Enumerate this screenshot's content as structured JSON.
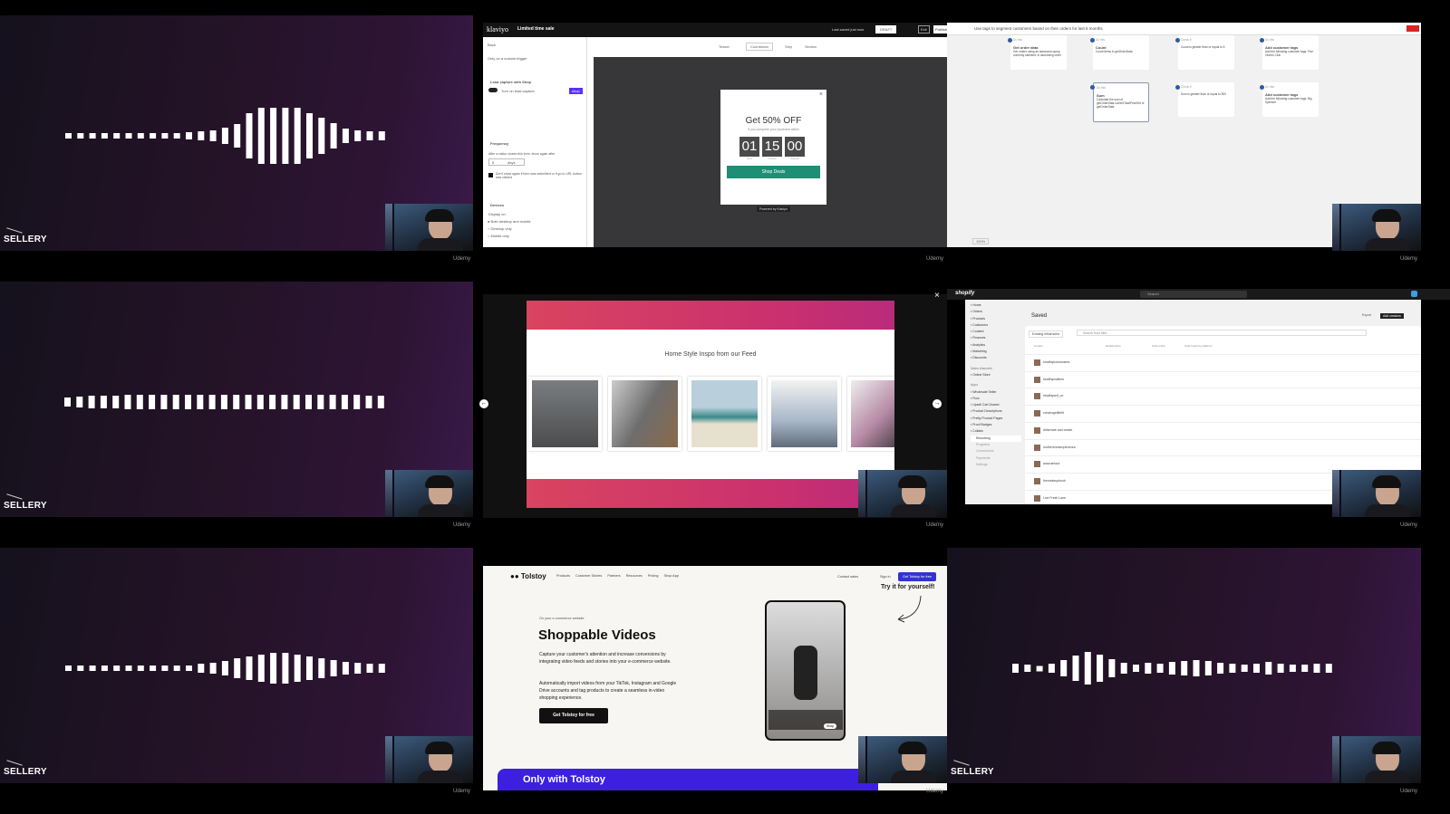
{
  "brand_logo": "SELLERY",
  "platform_label": "Udemy",
  "colors": {
    "bg_purple": "#2d1434",
    "klaviyo_teal": "#1e8e74",
    "tolstoy_blue": "#3533cd",
    "pink_banner": "#d2436a"
  },
  "klaviyo": {
    "app": "klaviyo",
    "title": "Limited time sale",
    "status": "Last saved just now",
    "status_select": "DRAFT",
    "exit": "Exit",
    "publish": "Publish",
    "back": "Back",
    "toolbar": [
      "Teaser",
      "Countdown",
      "Step",
      "Section"
    ],
    "trigger_option": "Only on a custom trigger",
    "lead_capture": {
      "heading": "Lead capture with Shop",
      "toggle_label": "Turn on lead capture",
      "badge": "shop"
    },
    "frequency": {
      "heading": "Frequency",
      "desc": "After a visitor closes this form, show again after",
      "value": "5",
      "unit": "days",
      "checkbox": "Don't show again if form was submitted or if go to URL button was clicked"
    },
    "devices": {
      "heading": "Devices",
      "label": "Display on",
      "options": [
        "Both desktop and mobile",
        "Desktop only",
        "Mobile only"
      ],
      "selected": 0
    },
    "popup": {
      "headline": "Get 50% OFF",
      "sub": "If you complete your purchase within",
      "timer": [
        "01",
        "15",
        "00"
      ],
      "timer_units": [
        "hours",
        "minutes",
        "seconds"
      ],
      "cta": "Shop Deals",
      "footer": "Powered by Klaviyo"
    }
  },
  "flow": {
    "title": "Use tags to segment customers based on their orders for last 6 months",
    "nodes": [
      {
        "label": "Do this",
        "title": "Get order data",
        "desc": "Get orders using an advanced query, currently selected: in ascending order"
      },
      {
        "label": "Do this",
        "title": "Count",
        "desc": "Count items in getOrderData"
      },
      {
        "label": "Check if",
        "title": "",
        "desc": "Count is greater than or equal to 5"
      },
      {
        "label": "Do this",
        "title": "Add customer tags",
        "desc": "Add the following customer tags: Five Orders Club"
      },
      {
        "label": "Do this",
        "title": "Sum",
        "desc": "Calculate the sum of getOrderData.currentTotalPriceSet of getOrderData"
      },
      {
        "label": "Check if",
        "title": "",
        "desc": "Sum is greater than or equal to 500"
      },
      {
        "label": "Do this",
        "title": "Add customer tags",
        "desc": "Add the following customer tags: Big Spender"
      }
    ],
    "zoom": "100%"
  },
  "carousel": {
    "heading": "Home Style Inspo from our Feed"
  },
  "shopify": {
    "app": "shopify",
    "search": "Search",
    "nav": [
      "Home",
      "Orders",
      "Products",
      "Customers",
      "Content",
      "Finances",
      "Analytics",
      "Marketing",
      "Discounts"
    ],
    "sales_channels": "Sales channels",
    "online_store": "Online Store",
    "apps_label": "Apps",
    "apps": [
      "Wholesale Seller",
      "Flow",
      "Upsell Cart Drawer",
      "Product Descriptions",
      "Pretty Product Pages",
      "Proof Badges",
      "Collabs"
    ],
    "collabs_sub": [
      "Recruiting",
      "Programs",
      "Connections",
      "Payments",
      "Settings"
    ],
    "settings": "Settings",
    "page_title": "Saved",
    "actions": [
      "Export",
      "Add creators"
    ],
    "filter": "Existing influencers",
    "search_placeholder": "Search from files",
    "columns": [
      "Creator",
      "Relationship",
      "Total reach",
      "Total reach by platform"
    ],
    "rows": [
      "healthyhomewares",
      "healthymatters",
      "healthyself_co",
      "creatorgetlifefit",
      "ditherrate and create",
      "mothercreatorpreneurs",
      "anavuefood",
      "themakeupbook",
      "Live Fresh Lane"
    ]
  },
  "tolstoy": {
    "brand": "Tolstoy",
    "nav": [
      "Products",
      "Customer Stories",
      "Partners",
      "Resources",
      "Pricing",
      "Shop App"
    ],
    "contact": "Contact sales",
    "signin": "Sign in",
    "cta_top": "Get Tolstoy for free",
    "try": "Try it for yourself!",
    "eyebrow": "On your e-commerce website",
    "headline": "Shoppable Videos",
    "p1": "Capture your customer's attention and increase conversions by integrating video feeds and stories into your e-commerce website.",
    "p2": "Automatically import videos from your TikTok, Instagram and Google Drive accounts and tag products to create a seamless in-video shopping experience.",
    "cta": "Get Tolstoy for free",
    "banner": "Only with Tolstoy",
    "video_shop": "Shop"
  }
}
